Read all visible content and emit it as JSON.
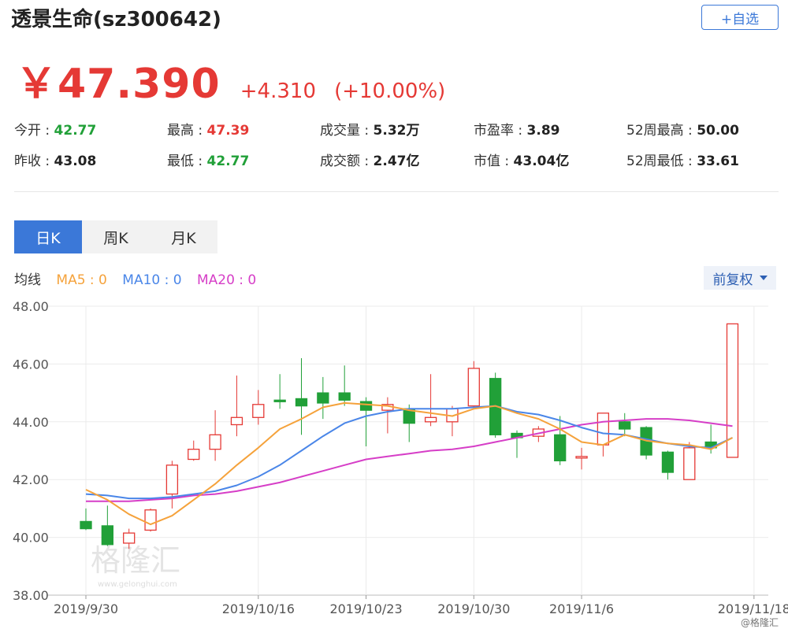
{
  "header": {
    "title": "透景生命(sz300642)",
    "add_label": "+自选"
  },
  "quote": {
    "price": "￥47.390",
    "change": "+4.310",
    "change_pct": "(+10.00%)"
  },
  "stats": [
    {
      "label": "今开",
      "value": "42.77",
      "tone": "down"
    },
    {
      "label": "最高",
      "value": "47.39",
      "tone": "up"
    },
    {
      "label": "成交量",
      "value": "5.32万",
      "tone": "neutral"
    },
    {
      "label": "市盈率",
      "value": "3.89",
      "tone": "neutral"
    },
    {
      "label": "52周最高",
      "value": "50.00",
      "tone": "neutral"
    },
    {
      "label": "昨收",
      "value": "43.08",
      "tone": "neutral"
    },
    {
      "label": "最低",
      "value": "42.77",
      "tone": "down"
    },
    {
      "label": "成交额",
      "value": "2.47亿",
      "tone": "neutral"
    },
    {
      "label": "市值",
      "value": "43.04亿",
      "tone": "neutral"
    },
    {
      "label": "52周最低",
      "value": "33.61",
      "tone": "neutral"
    }
  ],
  "tabs": [
    {
      "label": "日K",
      "active": true
    },
    {
      "label": "周K",
      "active": false
    },
    {
      "label": "月K",
      "active": false
    }
  ],
  "indicators": {
    "label": "均线",
    "ma5": "MA5 : 0",
    "ma10": "MA10 : 0",
    "ma20": "MA20 : 0"
  },
  "adjust_label": "前复权",
  "watermark": {
    "brand": "格隆汇",
    "url": "www.gelonghui.com",
    "corner": "@格隆汇"
  },
  "colors": {
    "up": "#e53935",
    "down": "#21a038",
    "accent": "#3b78d8",
    "ma5": "#f5a23b",
    "ma10": "#4a86e8",
    "ma20": "#d63ec7"
  },
  "chart_data": {
    "type": "candlestick",
    "ylim": [
      38.0,
      48.0
    ],
    "yticks": [
      "48.00",
      "46.00",
      "44.00",
      "42.00",
      "40.00",
      "38.00"
    ],
    "xtick_labels": [
      "2019/9/30",
      "2019/10/16",
      "2019/10/23",
      "2019/10/30",
      "2019/11/6",
      "2019/11/18"
    ],
    "xtick_index": [
      0,
      8,
      13,
      18,
      23,
      31
    ],
    "candles": [
      {
        "o": 40.55,
        "h": 41.0,
        "l": 40.25,
        "c": 40.3
      },
      {
        "o": 40.4,
        "h": 41.1,
        "l": 39.7,
        "c": 39.75
      },
      {
        "o": 39.8,
        "h": 40.3,
        "l": 39.6,
        "c": 40.15
      },
      {
        "o": 40.25,
        "h": 41.0,
        "l": 40.2,
        "c": 40.95
      },
      {
        "o": 41.5,
        "h": 42.65,
        "l": 41.0,
        "c": 42.5
      },
      {
        "o": 42.7,
        "h": 43.35,
        "l": 42.65,
        "c": 43.05
      },
      {
        "o": 43.05,
        "h": 44.4,
        "l": 42.65,
        "c": 43.55
      },
      {
        "o": 43.9,
        "h": 45.6,
        "l": 43.5,
        "c": 44.15
      },
      {
        "o": 44.15,
        "h": 45.1,
        "l": 43.9,
        "c": 44.6
      },
      {
        "o": 44.75,
        "h": 45.65,
        "l": 44.45,
        "c": 44.7
      },
      {
        "o": 44.8,
        "h": 46.2,
        "l": 43.55,
        "c": 44.55
      },
      {
        "o": 45.0,
        "h": 45.55,
        "l": 44.1,
        "c": 44.65
      },
      {
        "o": 45.0,
        "h": 45.95,
        "l": 44.55,
        "c": 44.75
      },
      {
        "o": 44.7,
        "h": 44.85,
        "l": 43.15,
        "c": 44.4
      },
      {
        "o": 44.4,
        "h": 44.85,
        "l": 43.6,
        "c": 44.6
      },
      {
        "o": 44.45,
        "h": 44.6,
        "l": 43.3,
        "c": 43.95
      },
      {
        "o": 44.0,
        "h": 45.65,
        "l": 43.85,
        "c": 44.15
      },
      {
        "o": 44.0,
        "h": 44.55,
        "l": 43.5,
        "c": 44.45
      },
      {
        "o": 44.55,
        "h": 46.1,
        "l": 44.5,
        "c": 45.85
      },
      {
        "o": 45.5,
        "h": 45.7,
        "l": 43.45,
        "c": 43.55
      },
      {
        "o": 43.6,
        "h": 43.7,
        "l": 42.75,
        "c": 43.45
      },
      {
        "o": 43.5,
        "h": 43.85,
        "l": 43.3,
        "c": 43.75
      },
      {
        "o": 43.55,
        "h": 44.2,
        "l": 42.5,
        "c": 42.65
      },
      {
        "o": 42.75,
        "h": 43.1,
        "l": 42.35,
        "c": 42.8
      },
      {
        "o": 43.2,
        "h": 44.3,
        "l": 42.8,
        "c": 44.3
      },
      {
        "o": 44.0,
        "h": 44.3,
        "l": 43.5,
        "c": 43.75
      },
      {
        "o": 43.8,
        "h": 43.85,
        "l": 42.7,
        "c": 42.85
      },
      {
        "o": 42.95,
        "h": 43.0,
        "l": 42.0,
        "c": 42.25
      },
      {
        "o": 42.0,
        "h": 43.3,
        "l": 42.0,
        "c": 43.1
      },
      {
        "o": 43.3,
        "h": 43.9,
        "l": 42.9,
        "c": 43.1
      },
      {
        "o": 42.77,
        "h": 47.39,
        "l": 42.77,
        "c": 47.39
      }
    ],
    "ma5": [
      41.65,
      41.3,
      40.8,
      40.45,
      40.75,
      41.3,
      41.85,
      42.5,
      43.1,
      43.75,
      44.1,
      44.5,
      44.65,
      44.6,
      44.55,
      44.4,
      44.3,
      44.2,
      44.45,
      44.55,
      44.3,
      44.1,
      43.75,
      43.3,
      43.2,
      43.55,
      43.35,
      43.25,
      43.2,
      43.05,
      43.45
    ],
    "ma10": [
      41.5,
      41.45,
      41.35,
      41.35,
      41.4,
      41.5,
      41.6,
      41.8,
      42.1,
      42.5,
      43.0,
      43.5,
      43.95,
      44.2,
      44.35,
      44.45,
      44.45,
      44.45,
      44.5,
      44.55,
      44.35,
      44.25,
      44.05,
      43.8,
      43.6,
      43.55,
      43.4,
      43.25,
      43.15,
      43.1,
      43.45
    ],
    "ma20": [
      41.25,
      41.25,
      41.25,
      41.3,
      41.35,
      41.45,
      41.5,
      41.6,
      41.75,
      41.9,
      42.1,
      42.3,
      42.5,
      42.7,
      42.8,
      42.9,
      43.0,
      43.05,
      43.15,
      43.3,
      43.45,
      43.6,
      43.75,
      43.9,
      44.0,
      44.05,
      44.1,
      44.1,
      44.05,
      43.95,
      43.85
    ]
  }
}
